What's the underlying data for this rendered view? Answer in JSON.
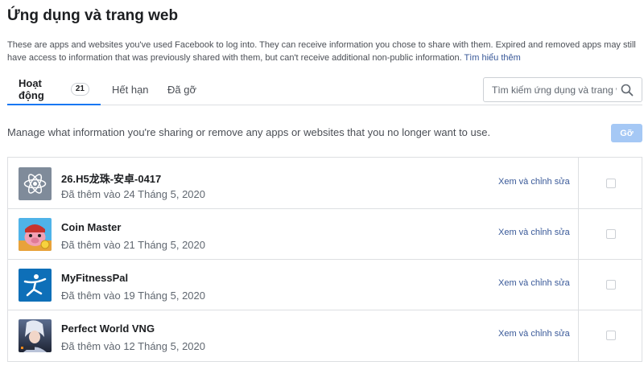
{
  "page": {
    "title": "Ứng dụng và trang web",
    "description": "These are apps and websites you've used Facebook to log into. They can receive information you chose to share with them. Expired and removed apps may still have access to information that was previously shared with them, but can't receive additional non-public information.",
    "learn_more": "Tìm hiểu thêm"
  },
  "tabs": {
    "active": {
      "label": "Hoạt động",
      "count": "21"
    },
    "expired": {
      "label": "Hết hạn"
    },
    "removed": {
      "label": "Đã gỡ"
    }
  },
  "search": {
    "placeholder": "Tìm kiếm ứng dụng và trang web"
  },
  "manage": {
    "text": "Manage what information you're sharing or remove any apps or websites that you no longer want to use.",
    "remove_label": "Gỡ"
  },
  "apps": [
    {
      "name": "26.H5龙珠-安卓-0417",
      "date": "Đã thêm vào 24 Tháng 5, 2020",
      "edit": "Xem và chỉnh sửa",
      "icon": "atom-icon"
    },
    {
      "name": "Coin Master",
      "date": "Đã thêm vào 21 Tháng 5, 2020",
      "edit": "Xem và chỉnh sửa",
      "icon": "coin-master-icon"
    },
    {
      "name": "MyFitnessPal",
      "date": "Đã thêm vào 19 Tháng 5, 2020",
      "edit": "Xem và chỉnh sửa",
      "icon": "myfitnesspal-icon"
    },
    {
      "name": "Perfect World VNG",
      "date": "Đã thêm vào 12 Tháng 5, 2020",
      "edit": "Xem và chỉnh sửa",
      "icon": "perfect-world-icon"
    }
  ],
  "colors": {
    "accent": "#1877f2",
    "link": "#385898",
    "button_disabled": "#a5c8f5"
  }
}
